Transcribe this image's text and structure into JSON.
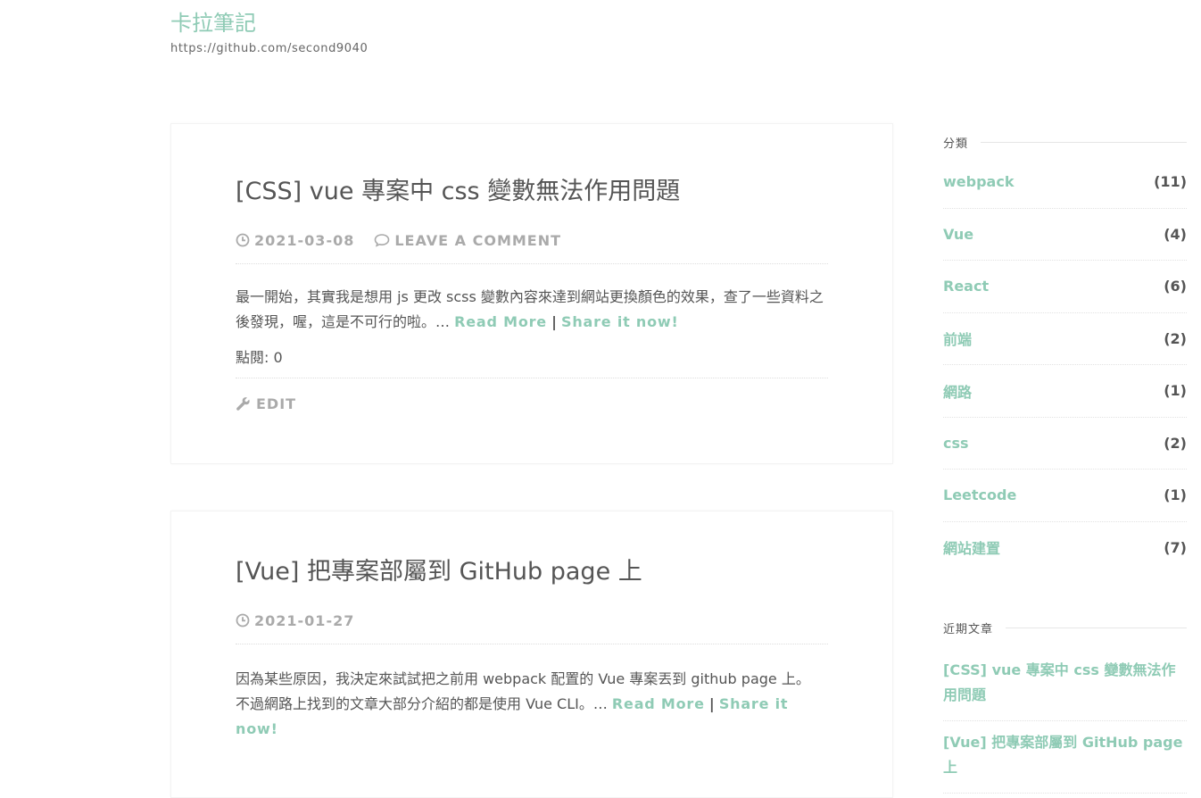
{
  "site": {
    "title": "卡拉筆記",
    "description": "https://github.com/second9040"
  },
  "posts": [
    {
      "title": "[CSS] vue 專案中 css 變數無法作用問題",
      "date": "2021-03-08",
      "comment_label": "LEAVE A COMMENT",
      "excerpt": "最一開始，其實我是想用 js 更改 scss 變數內容來達到網站更換顏色的效果，查了一些資料之後發現，喔，這是不可行的啦。…",
      "read_more": "Read More",
      "separator": "|",
      "share": "Share it now!",
      "views_label": "點閱: 0",
      "edit_label": "EDIT"
    },
    {
      "title": "[Vue] 把專案部屬到 GitHub page 上",
      "date": "2021-01-27",
      "excerpt_line1": "因為某些原因，我決定來試試把之前用 webpack 配置的 Vue 專案丟到 github page 上。",
      "excerpt_line2": "不過網路上找到的文章大部分介紹的都是使用 Vue CLI。…",
      "read_more": "Read More",
      "separator": "|",
      "share": "Share it now!"
    }
  ],
  "sidebar": {
    "categories_title": "分類",
    "categories": [
      {
        "name": "webpack",
        "count": "(11)"
      },
      {
        "name": "Vue",
        "count": "(4)"
      },
      {
        "name": "React",
        "count": "(6)"
      },
      {
        "name": "前端",
        "count": "(2)"
      },
      {
        "name": "網路",
        "count": "(1)"
      },
      {
        "name": "css",
        "count": "(2)"
      },
      {
        "name": "Leetcode",
        "count": "(1)"
      },
      {
        "name": "網站建置",
        "count": "(7)"
      }
    ],
    "recent_title": "近期文章",
    "recent": [
      "[CSS] vue 專案中 css 變數無法作用問題",
      "[Vue] 把專案部屬到 GitHub page 上"
    ]
  },
  "colors": {
    "accent": "#8fcbb5",
    "text": "#555555",
    "meta": "#aaaaaa"
  },
  "icons": {
    "date": "clock-icon",
    "comment": "comment-icon",
    "edit": "wrench-icon"
  }
}
